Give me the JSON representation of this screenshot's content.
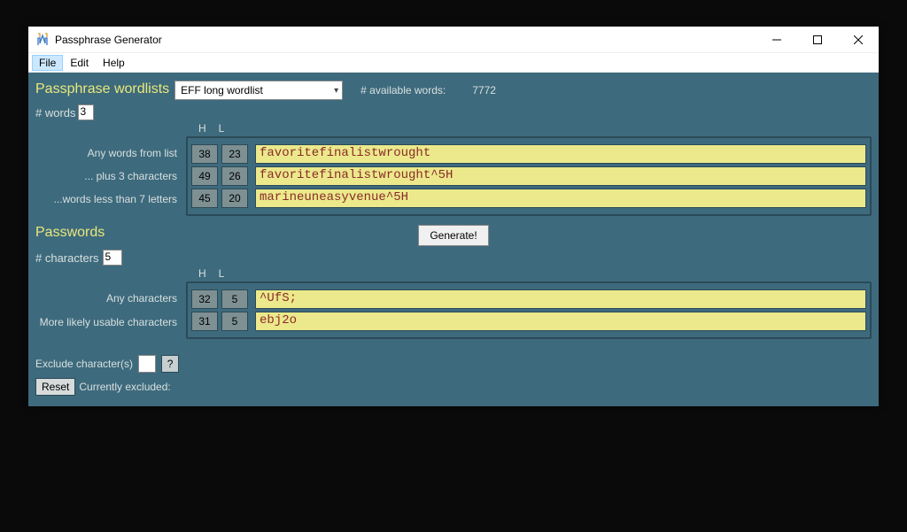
{
  "window": {
    "title": "Passphrase Generator"
  },
  "menu": {
    "file": "File",
    "edit": "Edit",
    "help": "Help"
  },
  "wordlists": {
    "header": "Passphrase wordlists",
    "selected": "EFF long wordlist",
    "available_label": "# available words:",
    "available_value": "7772",
    "num_words_label": "# words",
    "num_words_value": "3",
    "col_H": "H",
    "col_L": "L",
    "rows": [
      {
        "label": "Any words from list",
        "H": "38",
        "L": "23",
        "value": "favoritefinalistwrought"
      },
      {
        "label": "... plus 3 characters",
        "H": "49",
        "L": "26",
        "value": "favoritefinalistwrought^5H"
      },
      {
        "label": "...words less than 7 letters",
        "H": "45",
        "L": "20",
        "value": "marineuneasyvenue^5H"
      }
    ]
  },
  "passwords": {
    "header": "Passwords",
    "num_chars_label": "# characters",
    "num_chars_value": "5",
    "col_H": "H",
    "col_L": "L",
    "generate_label": "Generate!",
    "rows": [
      {
        "label": "Any characters",
        "H": "32",
        "L": "5",
        "value": "^UfS;"
      },
      {
        "label": "More likely usable characters",
        "H": "31",
        "L": "5",
        "value": "ebj2o"
      }
    ]
  },
  "exclude": {
    "label": "Exclude character(s)",
    "help": "?",
    "reset": "Reset",
    "currently": "Currently excluded:"
  }
}
